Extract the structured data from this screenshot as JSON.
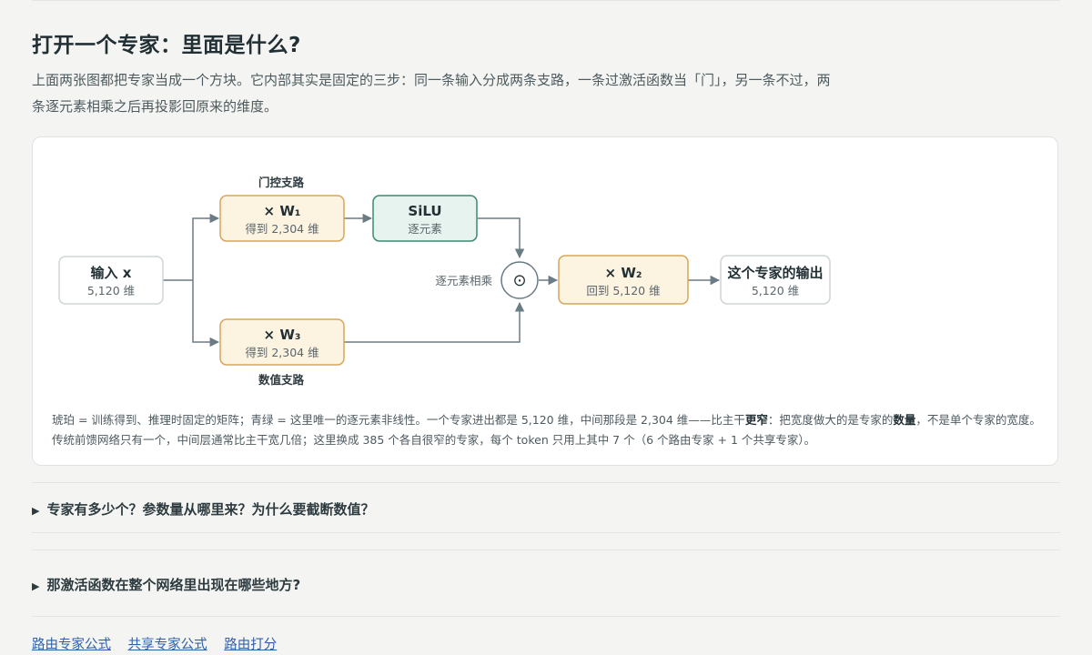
{
  "heading": "打开一个专家：里面是什么?",
  "intro": "上面两张图都把专家当成一个方块。它内部其实是固定的三步：同一条输入分成两条支路，一条过激活函数当「门」，另一条不过，两条逐元素相乘之后再投影回原来的维度。",
  "diagram": {
    "input": {
      "title": "输入 x",
      "sub": "5,120 维"
    },
    "gate_branch_label": "门控支路",
    "value_branch_label": "数值支路",
    "w1": {
      "title": "× W₁",
      "sub": "得到 2,304 维"
    },
    "silu": {
      "title": "SiLU",
      "sub": "逐元素"
    },
    "w3": {
      "title": "× W₃",
      "sub": "得到 2,304 维"
    },
    "multiply_label": "逐元素相乘",
    "multiply_symbol": "⊙",
    "w2": {
      "title": "× W₂",
      "sub": "回到 5,120 维"
    },
    "output": {
      "title": "这个专家的输出",
      "sub": "5,120 维"
    },
    "colors": {
      "amber_fill": "#fdf3e1",
      "amber_stroke": "#d6a75a",
      "teal_fill": "#e6f3ee",
      "teal_stroke": "#3d8a6e",
      "neutral_fill": "#ffffff",
      "neutral_stroke": "#cfd6d3",
      "arrow": "#6b7c85"
    }
  },
  "caption": {
    "part1": "琥珀 = 训练得到、推理时固定的矩阵；青绿 = 这里唯一的逐元素非线性。一个专家进出都是 5,120 维，中间那段是 2,304 维——比主干",
    "bold1": "更窄",
    "part2": "：把宽度做大的是专家的",
    "bold2": "数量",
    "part3": "，不是单个专家的宽度。传统前馈网络只有一个，中间层通常比主干宽几倍；这里换成 385 个各自很窄的专家，每个 token 只用上其中 7 个（6 个路由专家 + 1 个共享专家）。"
  },
  "details": [
    {
      "summary": "专家有多少个？参数量从哪里来？为什么要截断数值？"
    },
    {
      "summary": "那激活函数在整个网络里出现在哪些地方?"
    }
  ],
  "links": [
    "路由专家公式",
    "共享专家公式",
    "路由打分"
  ]
}
